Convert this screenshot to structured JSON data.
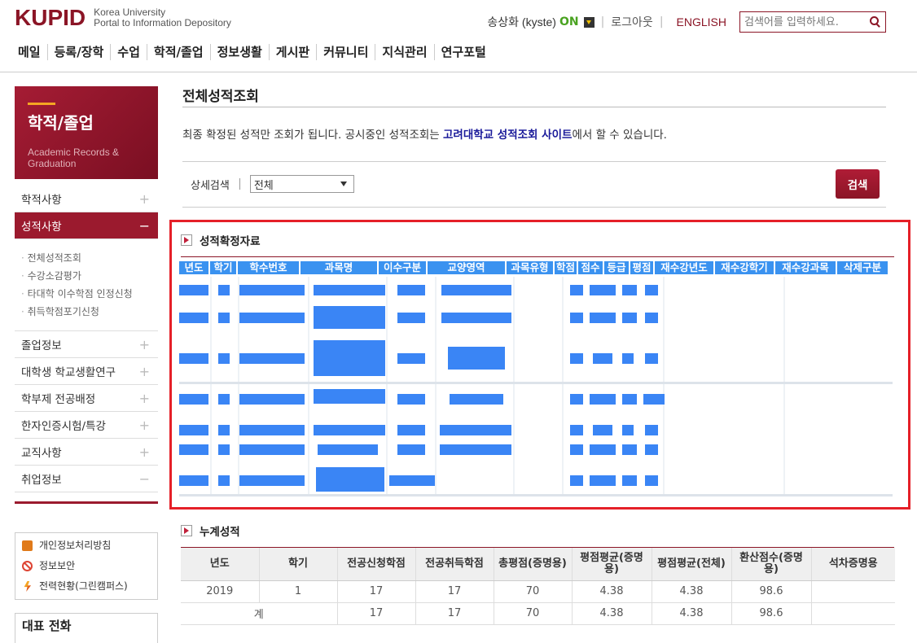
{
  "header": {
    "logo": "KUPID",
    "logo_sub_1": "Korea University",
    "logo_sub_2": "Portal to Information Depository",
    "user": "송상화 (kyste)",
    "status": "ON",
    "logout": "로그아웃",
    "language": "ENGLISH",
    "search_placeholder": "검색어를 입력하세요."
  },
  "gnb": [
    "메일",
    "등록/장학",
    "수업",
    "학적/졸업",
    "정보생활",
    "게시판",
    "커뮤니티",
    "지식관리",
    "연구포털"
  ],
  "sidebar": {
    "title": "학적/졸업",
    "subtitle_1": "Academic Records &",
    "subtitle_2": "Graduation",
    "menu_1": "학적사항",
    "menu_2": "성적사항",
    "sub_items": [
      "전체성적조회",
      "수강소감평가",
      "타대학 이수학점 인정신청",
      "취득학점포기신청"
    ],
    "menu_rest": [
      "졸업정보",
      "대학생 학교생활연구",
      "학부제 전공배정",
      "한자인증시험/특강",
      "교직사항",
      "취업정보"
    ],
    "util": [
      "개인정보처리방침",
      "정보보안",
      "전력현황(그린캠퍼스)"
    ],
    "phone_title": "대표 전화"
  },
  "main": {
    "title": "전체성적조회",
    "notice_pre": "최종 확정된 성적만 조회가 됩니다. 공시중인 성적조회는 ",
    "notice_link": "고려대학교 성적조회 사이트",
    "notice_post": "에서 할 수 있습니다.",
    "filter_label": "상세검색",
    "filter_value": "전체",
    "search_button": "검색",
    "section1_title": "성적확정자료",
    "grade_headers": [
      "년도",
      "학기",
      "학수번호",
      "과목명",
      "이수구분",
      "교양영역",
      "과목유형",
      "학점",
      "점수",
      "등급",
      "평점",
      "재수강년도",
      "재수강학기",
      "재수강과목",
      "삭제구분"
    ],
    "section2_title": "누계성적",
    "cum_headers": [
      "년도",
      "학기",
      "전공신청학점",
      "전공취득학점",
      "총평점(증명용)",
      "평점평균(증명용)",
      "평점평균(전체)",
      "환산점수(증명용)",
      "석차증명용"
    ],
    "cum_rows": [
      [
        "2019",
        "1",
        "17",
        "17",
        "70",
        "4.38",
        "4.38",
        "98.6",
        ""
      ],
      [
        "계",
        "",
        "17",
        "17",
        "70",
        "4.38",
        "4.38",
        "98.6",
        ""
      ]
    ]
  },
  "colors": {
    "brand": "#8b1526",
    "highlight": "#e52028",
    "redacted": "#3a85f5"
  }
}
